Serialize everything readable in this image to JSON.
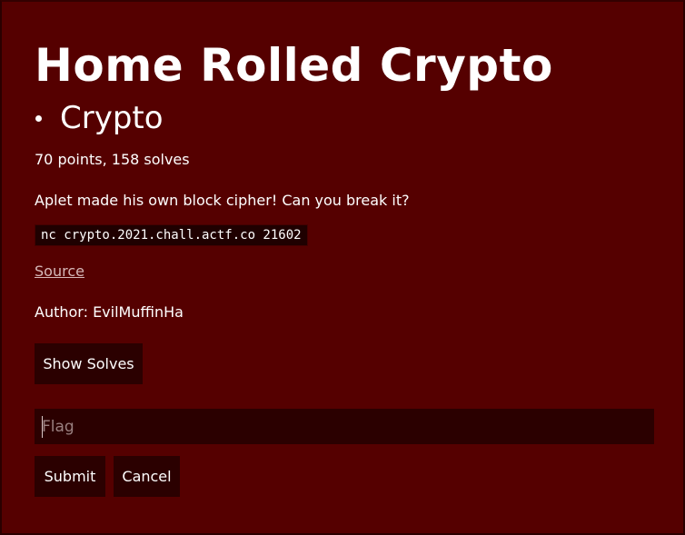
{
  "challenge": {
    "title": "Home Rolled Crypto",
    "category": "Crypto",
    "stats": "70 points, 158 solves",
    "description": "Aplet made his own block cipher! Can you break it?",
    "command": "nc crypto.2021.chall.actf.co 21602",
    "source_link": "Source",
    "author": "Author: EvilMuffinHa"
  },
  "actions": {
    "show_solves_label": "Show Solves",
    "submit_label": "Submit",
    "cancel_label": "Cancel"
  },
  "flag_input": {
    "placeholder": "Flag",
    "value": ""
  },
  "colors": {
    "panel_background": "#550000",
    "button_background": "#2b0000",
    "text": "#ffffff",
    "link": "#d6b8b8"
  }
}
